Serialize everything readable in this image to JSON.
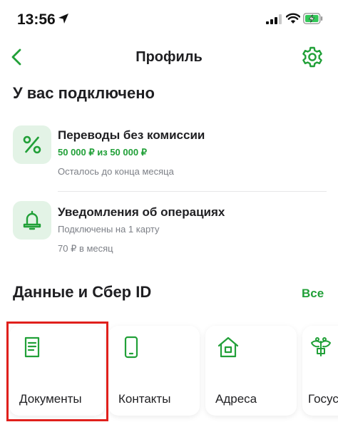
{
  "status_bar": {
    "time": "13:56"
  },
  "nav": {
    "title": "Профиль"
  },
  "connected": {
    "title": "У вас подключено",
    "services": [
      {
        "title": "Переводы без комиссии",
        "limit": "50 000 ₽ из 50 000 ₽",
        "note": "Осталось до конца месяца",
        "icon": "percent-icon"
      },
      {
        "title": "Уведомления об операциях",
        "detail": "Подключены на 1 карту",
        "price": "70 ₽ в месяц",
        "icon": "bell-icon"
      }
    ]
  },
  "data_section": {
    "title": "Данные и Сбер ID",
    "all_label": "Все",
    "cards": [
      {
        "label": "Документы",
        "icon": "document-icon"
      },
      {
        "label": "Контакты",
        "icon": "phone-icon"
      },
      {
        "label": "Адреса",
        "icon": "home-icon"
      },
      {
        "label": "Госуслуги",
        "icon": "emblem-icon"
      }
    ]
  },
  "colors": {
    "accent": "#21a038",
    "icon_bg": "#e3f3e6",
    "highlight": "#e0201c"
  }
}
